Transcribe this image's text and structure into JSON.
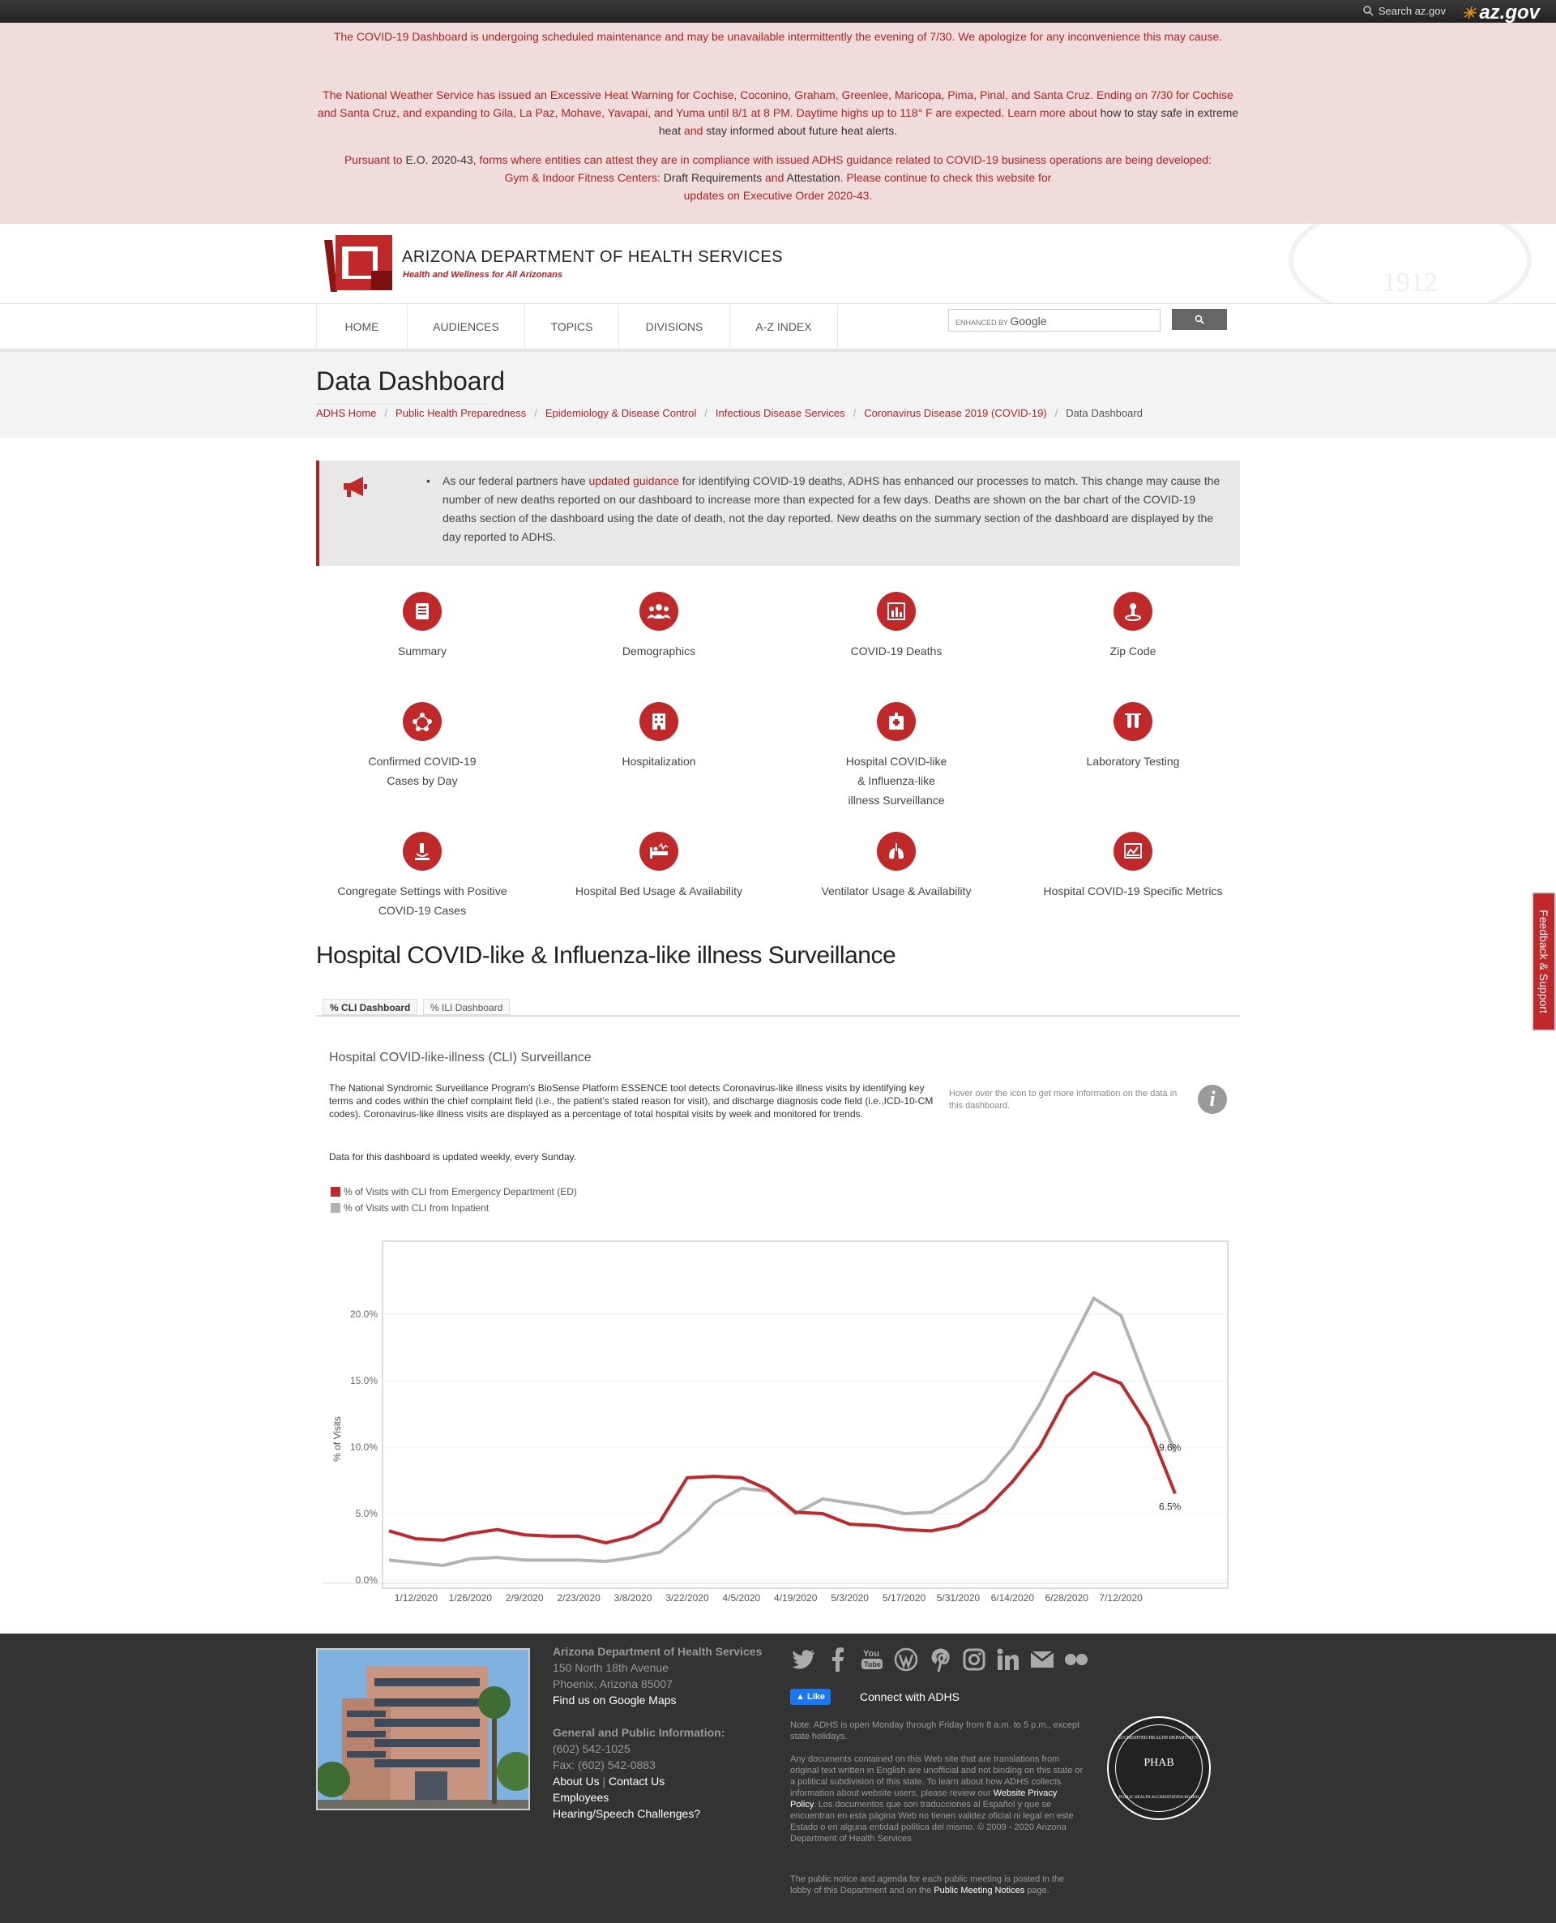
{
  "topbar": {
    "search_label": "Search az.gov",
    "brand": "az.gov"
  },
  "alerts": {
    "maintenance": "The COVID-19 Dashboard is undergoing scheduled maintenance and may be unavailable intermittently the evening of 7/30. We apologize for any inconvenience this may cause.",
    "heat_1": "The National Weather Service has issued an Excessive Heat Warning for Cochise, Coconino, Graham, Greenlee, Maricopa, Pima, Pinal, and Santa Cruz. Ending on 7/30 for Cochise and Santa Cruz, and expanding to Gila, La Paz, Mohave, Yavapai, and Yuma until 8/1 at 8 PM. Daytime highs up to 118° F are expected. Learn more about ",
    "heat_link": "how to stay safe in extreme heat",
    "heat_and": " and ",
    "heat_link2": "stay informed about future heat alerts.",
    "eo_1": "Pursuant to ",
    "eo_link": "E.O. 2020-43",
    "eo_2": ", forms where entities can attest they are in compliance with issued ADHS guidance related to COVID-19 business operations are being developed:",
    "eo_gym": "Gym & Indoor Fitness Centers: ",
    "eo_draft": "Draft Requirements",
    "eo_and": " and ",
    "eo_attest": "Attestation",
    "eo_3": ". Please continue to check this website for",
    "eo_4": "updates on Executive Order 2020-43."
  },
  "header": {
    "org_name": "ARIZONA DEPARTMENT OF HEALTH SERVICES",
    "tagline": "Health and Wellness for All Arizonans",
    "seal_year": "1912"
  },
  "nav": {
    "items": [
      "HOME",
      "AUDIENCES",
      "TOPICS",
      "DIVISIONS",
      "A-Z INDEX"
    ],
    "search_prefix": "ENHANCED BY",
    "search_brand": "Google"
  },
  "page": {
    "title": "Data Dashboard",
    "breadcrumbs": [
      "ADHS Home",
      "Public Health Preparedness",
      "Epidemiology & Disease Control",
      "Infectious Disease Services",
      "Coronavirus Disease 2019 (COVID-19)"
    ],
    "breadcrumb_current": "Data Dashboard"
  },
  "notice": {
    "text_1": "As our federal partners have ",
    "link": "updated guidance",
    "text_2": " for identifying COVID-19 deaths, ADHS has enhanced our processes to match. This change may cause the number of new deaths reported on our dashboard to increase more than expected for a few days. Deaths are shown on the bar chart of the COVID-19 deaths section of the dashboard using the date of death, not the day reported. New deaths on the summary section of the dashboard are displayed by the day reported to ADHS."
  },
  "tiles": [
    {
      "icon": "book-icon",
      "label": "Summary"
    },
    {
      "icon": "people-icon",
      "label": "Demographics"
    },
    {
      "icon": "bar-chart-icon",
      "label": "COVID-19 Deaths"
    },
    {
      "icon": "location-pin-icon",
      "label": "Zip Code"
    },
    {
      "icon": "network-icon",
      "label": "Confirmed COVID-19 Cases by Day"
    },
    {
      "icon": "building-icon",
      "label": "Hospitalization"
    },
    {
      "icon": "hospital-icon",
      "label": "Hospital COVID-like & Influenza-like illness Surveillance"
    },
    {
      "icon": "test-tubes-icon",
      "label": "Laboratory Testing"
    },
    {
      "icon": "microscope-icon",
      "label": "Congregate Settings with Positive COVID-19 Cases"
    },
    {
      "icon": "hospital-bed-icon",
      "label": "Hospital Bed Usage & Availability"
    },
    {
      "icon": "lungs-icon",
      "label": "Ventilator Usage & Availability"
    },
    {
      "icon": "line-chart-icon",
      "label": "Hospital COVID-19 Specific Metrics"
    }
  ],
  "section": {
    "title": "Hospital COVID-like & Influenza-like illness Surveillance",
    "tabs": [
      "% CLI Dashboard",
      "% ILI Dashboard"
    ]
  },
  "dashboard": {
    "title": "Hospital COVID-like-illness (CLI) Surveillance",
    "description": "The National Syndromic Surveillance Program's BioSense Platform ESSENCE tool detects Coronavirus-like illness visits by identifying key terms and codes within the chief complaint field (i.e., the patient's stated reason for visit), and discharge diagnosis code field (i.e.,ICD-10-CM codes).  Coronavirus-like illness visits are displayed as a percentage of total hospital visits by week and monitored for trends.",
    "update_note": "Data for this dashboard is updated weekly, every Sunday.",
    "hover_note": "Hover over the icon to get more information on the data in this dashboard.",
    "info_glyph": "i"
  },
  "chart_data": {
    "type": "line",
    "ylabel": "% of Visits",
    "ylim": [
      0,
      23
    ],
    "yticks": [
      "0.0%",
      "5.0%",
      "10.0%",
      "15.0%",
      "20.0%"
    ],
    "ytick_values": [
      0,
      5,
      10,
      15,
      20
    ],
    "xtick_labels": [
      "1/12/2020",
      "1/26/2020",
      "2/9/2020",
      "2/23/2020",
      "3/8/2020",
      "3/22/2020",
      "4/5/2020",
      "4/19/2020",
      "5/3/2020",
      "5/17/2020",
      "5/31/2020",
      "6/14/2020",
      "6/28/2020",
      "7/12/2020"
    ],
    "x": [
      "1/5/2020",
      "1/12/2020",
      "1/19/2020",
      "1/26/2020",
      "2/2/2020",
      "2/9/2020",
      "2/16/2020",
      "2/23/2020",
      "3/1/2020",
      "3/8/2020",
      "3/15/2020",
      "3/22/2020",
      "3/29/2020",
      "4/5/2020",
      "4/12/2020",
      "4/19/2020",
      "4/26/2020",
      "5/3/2020",
      "5/10/2020",
      "5/17/2020",
      "5/24/2020",
      "5/31/2020",
      "6/7/2020",
      "6/14/2020",
      "6/21/2020",
      "6/28/2020",
      "7/5/2020",
      "7/12/2020",
      "7/19/2020"
    ],
    "series": [
      {
        "name": "% of Visits with CLI from Emergency Department (ED)",
        "color": "#c0282a",
        "values": [
          3.7,
          3.1,
          3.0,
          3.5,
          3.8,
          3.4,
          3.3,
          3.3,
          2.8,
          3.3,
          4.4,
          7.7,
          7.8,
          7.7,
          6.8,
          5.1,
          5.0,
          4.2,
          4.1,
          3.8,
          3.7,
          4.1,
          5.3,
          7.4,
          10.0,
          13.8,
          15.6,
          14.8,
          11.6,
          6.5
        ],
        "end_label": "6.5%"
      },
      {
        "name": "% of Visits with CLI from Inpatient",
        "color": "#b3b3b3",
        "values": [
          1.5,
          1.3,
          1.1,
          1.6,
          1.7,
          1.5,
          1.5,
          1.5,
          1.4,
          1.7,
          2.1,
          3.7,
          5.8,
          6.9,
          6.7,
          5.0,
          6.1,
          5.8,
          5.5,
          5.0,
          5.1,
          6.2,
          7.5,
          9.9,
          13.2,
          17.2,
          21.2,
          19.9,
          14.6,
          9.6
        ],
        "end_label": "9.6%"
      }
    ],
    "grid": true
  },
  "feedback": "Feedback & Support",
  "footer": {
    "org_name": "Arizona Department of Health Services",
    "address_1": "150 North 18th Avenue",
    "address_2": "Phoenix, Arizona 85007",
    "maps_link": "Find us on Google Maps",
    "info_heading": "General and Public Information:",
    "phone": "(602) 542-1025",
    "fax": "Fax: (602) 542-0883",
    "about": "About Us",
    "contact": "Contact Us",
    "employees": "Employees",
    "hearing": "Hearing/Speech Challenges?",
    "social_icons": [
      "twitter-icon",
      "facebook-icon",
      "youtube-icon",
      "wordpress-icon",
      "pinterest-icon",
      "instagram-icon",
      "linkedin-icon",
      "email-icon",
      "flickr-icon"
    ],
    "like": "Like",
    "connect": "Connect with ADHS",
    "hours_note": "Note: ADHS is open Monday through Friday from 8 a.m. to 5 p.m., except state holidays.",
    "translation_1": "Any documents contained on this Web site that are translations from original text written in English are unofficial and not binding on this state or a political subdivision of this state. To learn about how ADHS collects information about website users, please review our ",
    "privacy_link": "Website Privacy Policy",
    "translation_2": ". Los documentos que son traducciones al Español y que se encuentran en esta página Web no tienen validez oficial ni legal en este Estado o en alguna entidad política del mismo. © 2009 - 2020 Arizona Department of Health Services",
    "meeting_1": "The public notice and agenda for each public meeting is posted in the lobby of this Department and on the ",
    "meeting_link": "Public Meeting Notices",
    "meeting_2": " page.",
    "phab_top": "ACCREDITED HEALTH DEPARTMENT",
    "phab_mark": "PHAB",
    "phab_bottom": "PUBLIC HEALTH ACCREDITATION BOARD"
  }
}
